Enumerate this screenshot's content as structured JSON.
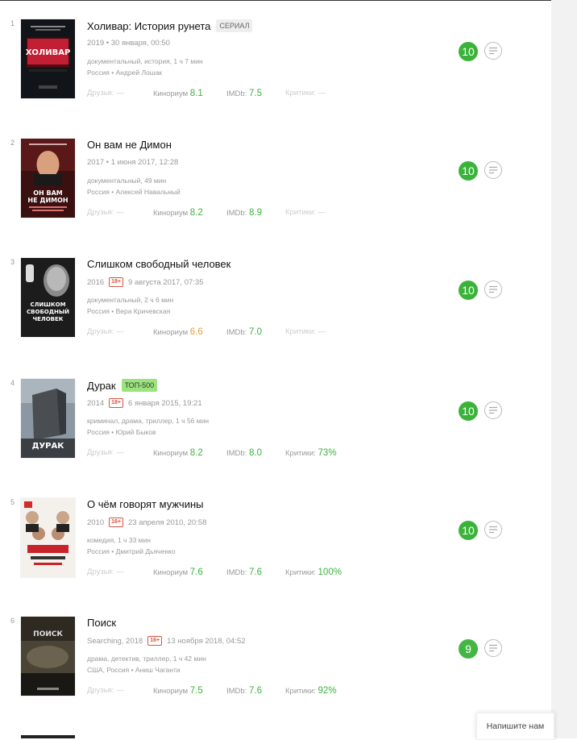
{
  "items": [
    {
      "index": "1",
      "title": "Холивар: История рунета",
      "tag": "СЕРИАЛ",
      "year": "2019",
      "age": "",
      "date_text": "• 30 января, 00:50",
      "genres": "документальный, история, 1 ч 7 мин",
      "crew": "Россия • Андрей Лошак",
      "friends_label": "Друзья:",
      "friends_value": "—",
      "kinorium_label": "Кинориум",
      "kinorium_value": "8.1",
      "imdb_label": "IMDb:",
      "imdb_value": "7.5",
      "critics_label": "Критики:",
      "critics_value": "—",
      "my_score": "10",
      "poster_text": "ХОЛИВАР",
      "poster_bg": "#111418"
    },
    {
      "index": "2",
      "title": "Он вам не Димон",
      "tag": "",
      "year": "2017",
      "age": "",
      "date_text": "• 1 июня 2017, 12:28",
      "genres": "документальный, 49 мин",
      "crew": "Россия • Алексей Навальный",
      "friends_label": "Друзья:",
      "friends_value": "—",
      "kinorium_label": "Кинориум",
      "kinorium_value": "8.2",
      "imdb_label": "IMDb:",
      "imdb_value": "8.9",
      "critics_label": "Критики:",
      "critics_value": "—",
      "my_score": "10",
      "poster_text": "ОН ВАМ НЕ ДИМОН",
      "poster_bg": "#3a1010"
    },
    {
      "index": "3",
      "title": "Слишком свободный человек",
      "tag": "",
      "year": "2016",
      "age": "18+",
      "date_text": "9 августа 2017, 07:35",
      "genres": "документальный, 2 ч 6 мин",
      "crew": "Россия • Вера Кричевская",
      "friends_label": "Друзья:",
      "friends_value": "—",
      "kinorium_label": "Кинориум",
      "kinorium_value": "6.6",
      "imdb_label": "IMDb:",
      "imdb_value": "7.0",
      "critics_label": "Критики:",
      "critics_value": "—",
      "my_score": "10",
      "poster_text": "СЛИШКОМ СВОБОДНЫЙ ЧЕЛОВЕК",
      "poster_bg": "#1c1c1c"
    },
    {
      "index": "4",
      "title": "Дурак",
      "tag": "ТОП-500",
      "year": "2014",
      "age": "18+",
      "date_text": "6 января 2015, 19:21",
      "genres": "криминал, драма, триллер, 1 ч 56 мин",
      "crew": "Россия • Юрий Быков",
      "friends_label": "Друзья:",
      "friends_value": "—",
      "kinorium_label": "Кинориум",
      "kinorium_value": "8.2",
      "imdb_label": "IMDb:",
      "imdb_value": "8.0",
      "critics_label": "Критики:",
      "critics_value": "73%",
      "my_score": "10",
      "poster_text": "ДУРАК",
      "poster_bg": "#6d7d8a"
    },
    {
      "index": "5",
      "title": "О чём говорят мужчины",
      "tag": "",
      "year": "2010",
      "age": "16+",
      "date_text": "23 апреля 2010, 20:58",
      "genres": "комедия, 1 ч 33 мин",
      "crew": "Россия • Дмитрий Дьяченко",
      "friends_label": "Друзья:",
      "friends_value": "—",
      "kinorium_label": "Кинориум",
      "kinorium_value": "7.6",
      "imdb_label": "IMDb:",
      "imdb_value": "7.6",
      "critics_label": "Критики:",
      "critics_value": "100%",
      "my_score": "10",
      "poster_text": "О ЧЁМ ГОВОРЯТ МУЖЧИНЫ",
      "poster_bg": "#f4f1ec"
    },
    {
      "index": "6",
      "title": "Поиск",
      "tag": "",
      "year": "Searching, 2018",
      "age": "16+",
      "date_text": "13 ноября 2018, 04:52",
      "genres": "драма, детектив, триллер, 1 ч 42 мин",
      "crew": "США, Россия • Аниш Чаганти",
      "friends_label": "Друзья:",
      "friends_value": "—",
      "kinorium_label": "Кинориум",
      "kinorium_value": "7.5",
      "imdb_label": "IMDb:",
      "imdb_value": "7.6",
      "critics_label": "Критики:",
      "critics_value": "92%",
      "my_score": "9",
      "poster_text": "ПОИСК",
      "poster_bg": "#2e2a22"
    }
  ],
  "chat_button": "Напишите нам",
  "colors": {
    "accent_green": "#3bb33b",
    "rating_orange": "#e5a13b",
    "age_red": "#d9533e"
  }
}
